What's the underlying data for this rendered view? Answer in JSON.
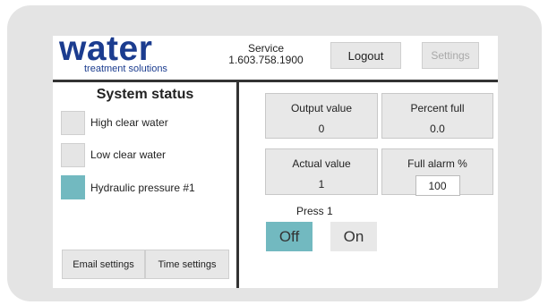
{
  "header": {
    "logo_main": "water",
    "logo_sub": "treatment solutions",
    "service_title": "Service",
    "service_phone": "1.603.758.1900",
    "logout_label": "Logout",
    "settings_label": "Settings"
  },
  "system_status": {
    "title": "System status",
    "items": [
      {
        "label": "High clear water",
        "active": false
      },
      {
        "label": "Low clear water",
        "active": false
      },
      {
        "label": "Hydraulic pressure #1",
        "active": true
      }
    ],
    "email_settings_label": "Email settings",
    "time_settings_label": "Time settings"
  },
  "readouts": {
    "output_value_label": "Output value",
    "output_value": "0",
    "percent_full_label": "Percent full",
    "percent_full": "0.0",
    "actual_value_label": "Actual value",
    "actual_value": "1",
    "full_alarm_label": "Full alarm %",
    "full_alarm_value": "100"
  },
  "press": {
    "label": "Press 1",
    "off_label": "Off",
    "on_label": "On",
    "state": "Off"
  },
  "colors": {
    "brand_blue": "#1b3c8f",
    "active_teal": "#72b9c0",
    "tile_gray": "#e8e8e8",
    "divider": "#333333"
  }
}
